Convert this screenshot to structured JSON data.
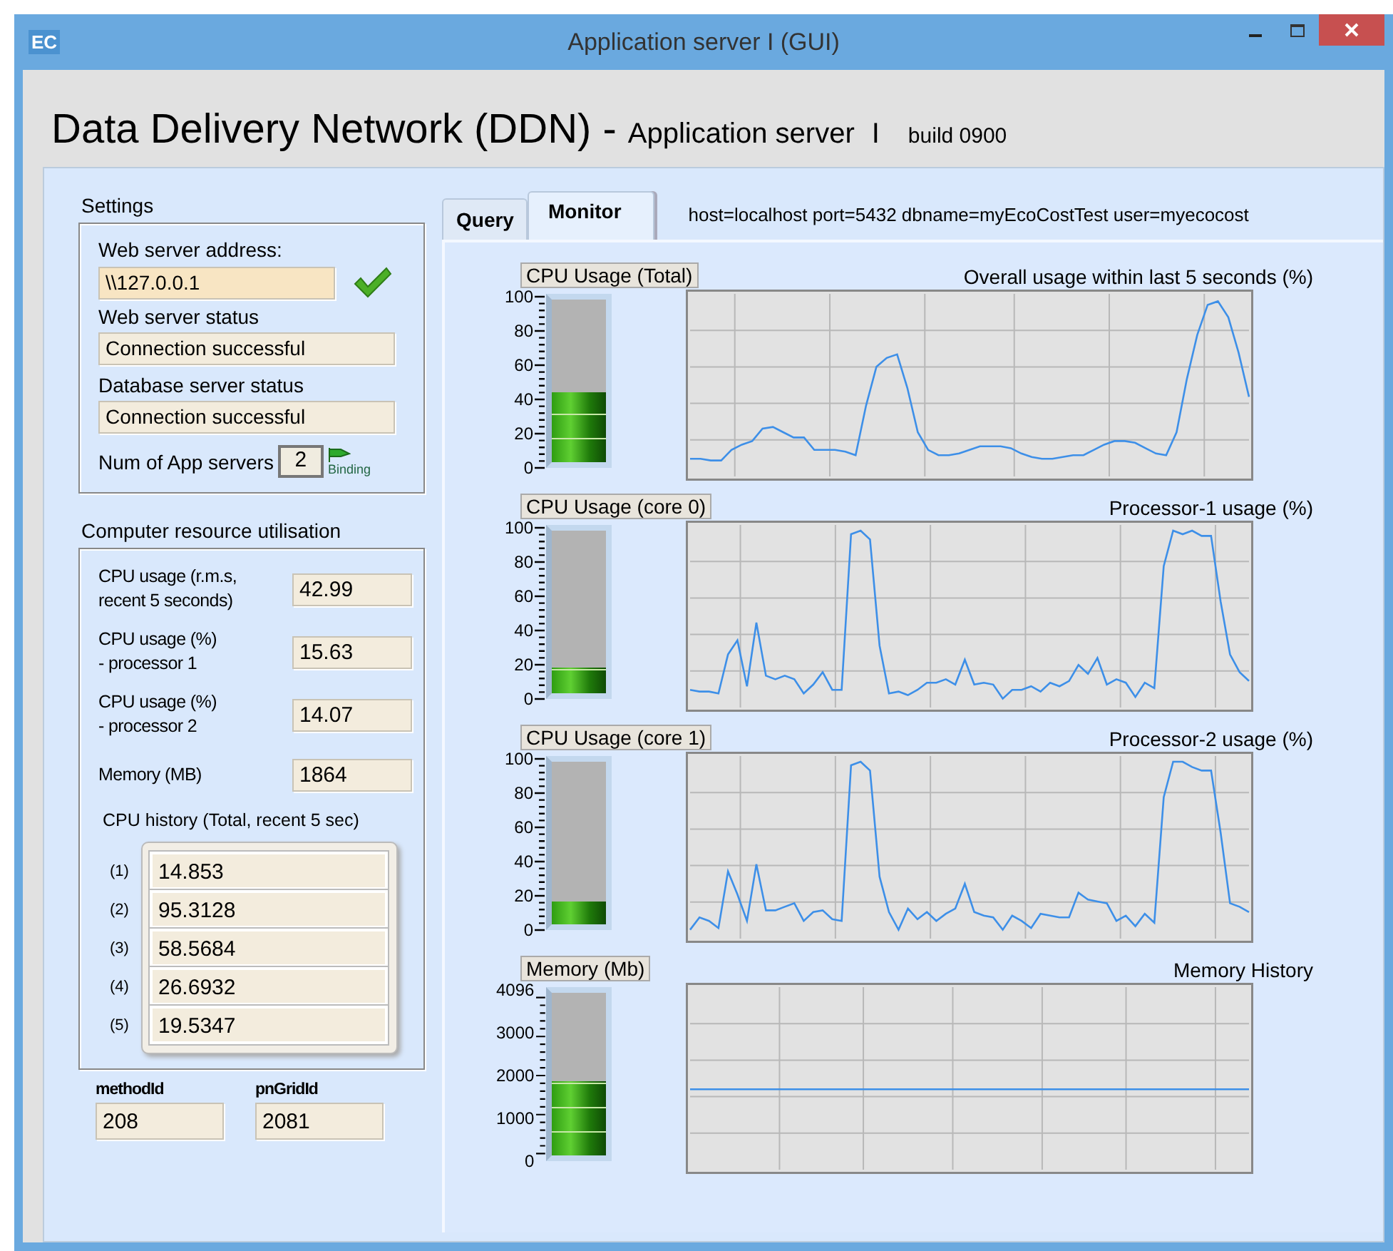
{
  "window": {
    "icon_text": "EC",
    "title": "Application server I (GUI)"
  },
  "header": {
    "title": "Data Delivery Network (DDN) -",
    "subtitle": "Application server",
    "instance": "I",
    "build": "build 0900"
  },
  "settings": {
    "title": "Settings",
    "address_label": "Web server address:",
    "address_value": "\\\\127.0.0.1",
    "web_status_label": "Web server status",
    "web_status_value": "Connection successful",
    "db_status_label": "Database server status",
    "db_status_value": "Connection successful",
    "app_servers_label": "Num of App servers",
    "app_servers_value": "2",
    "binding_label": "Binding"
  },
  "resources": {
    "title": "Computer resource utilisation",
    "rows": [
      {
        "label": "CPU usage (r.m.s,\nrecent 5 seconds)",
        "value": "42.99"
      },
      {
        "label": "CPU usage (%)\n - processor 1",
        "value": "15.63"
      },
      {
        "label": "CPU usage (%)\n - processor 2",
        "value": "14.07"
      },
      {
        "label": "Memory (MB)",
        "value": "1864"
      }
    ],
    "history_title": "CPU history  (Total, recent 5 sec)",
    "history": [
      {
        "index": "(1)",
        "value": "14.853"
      },
      {
        "index": "(2)",
        "value": "95.3128"
      },
      {
        "index": "(3)",
        "value": "58.5684"
      },
      {
        "index": "(4)",
        "value": "26.6932"
      },
      {
        "index": "(5)",
        "value": "19.5347"
      }
    ]
  },
  "ids": [
    {
      "label": "methodId",
      "value": "208"
    },
    {
      "label": "pnGridId",
      "value": "2081"
    }
  ],
  "tabs": [
    {
      "label": "Query",
      "selected": false
    },
    {
      "label": "Monitor",
      "selected": true
    }
  ],
  "connection": "host=localhost port=5432 dbname=myEcoCostTest user=myecocost",
  "monitors": [
    {
      "gauge_label": "CPU Usage (Total)",
      "level": 0.43,
      "ticks": [
        "100",
        "80",
        "60",
        "40",
        "20",
        "0"
      ],
      "chart_title": "Overall usage within last 5 seconds (%)"
    },
    {
      "gauge_label": "CPU Usage (core 0)",
      "level": 0.16,
      "ticks": [
        "100",
        "80",
        "60",
        "40",
        "20",
        "0"
      ],
      "chart_title": "Processor-1 usage (%)"
    },
    {
      "gauge_label": "CPU Usage (core 1)",
      "level": 0.14,
      "ticks": [
        "100",
        "80",
        "60",
        "40",
        "20",
        "0"
      ],
      "chart_title": "Processor-2 usage (%)"
    },
    {
      "gauge_label": "Memory (Mb)",
      "level": 0.455,
      "ticks": [
        "4096",
        "3000",
        "2000",
        "1000",
        "0"
      ],
      "chart_title": "Memory History"
    }
  ]
}
